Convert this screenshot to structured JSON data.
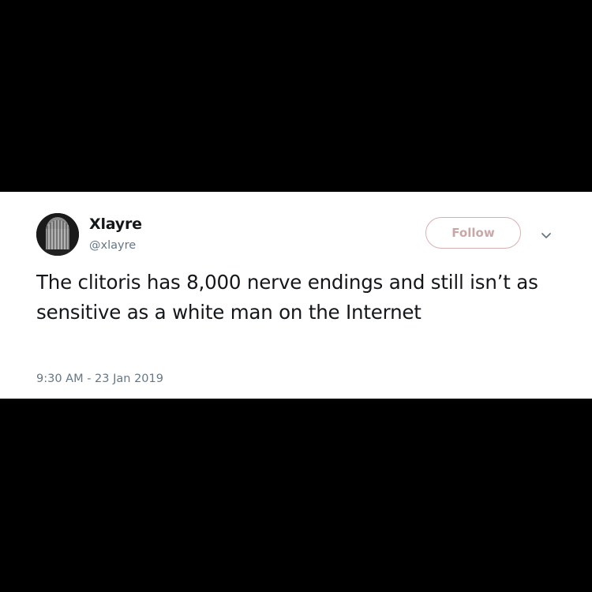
{
  "tweet": {
    "display_name": "Xlayre",
    "handle": "@xlayre",
    "follow_label": "Follow",
    "text": "The clitoris has 8,000 nerve endings and still isn’t as sensitive as a white man on the Internet",
    "timestamp": "9:30 AM - 23 Jan 2019",
    "avatar_icon": "profile-photo",
    "menu_icon": "chevron-down-icon"
  },
  "colors": {
    "background": "#000000",
    "card": "#ffffff",
    "text_primary": "#14171a",
    "text_secondary": "#657786",
    "follow_border": "#d8b0b0",
    "follow_text": "#c9a7a7"
  }
}
